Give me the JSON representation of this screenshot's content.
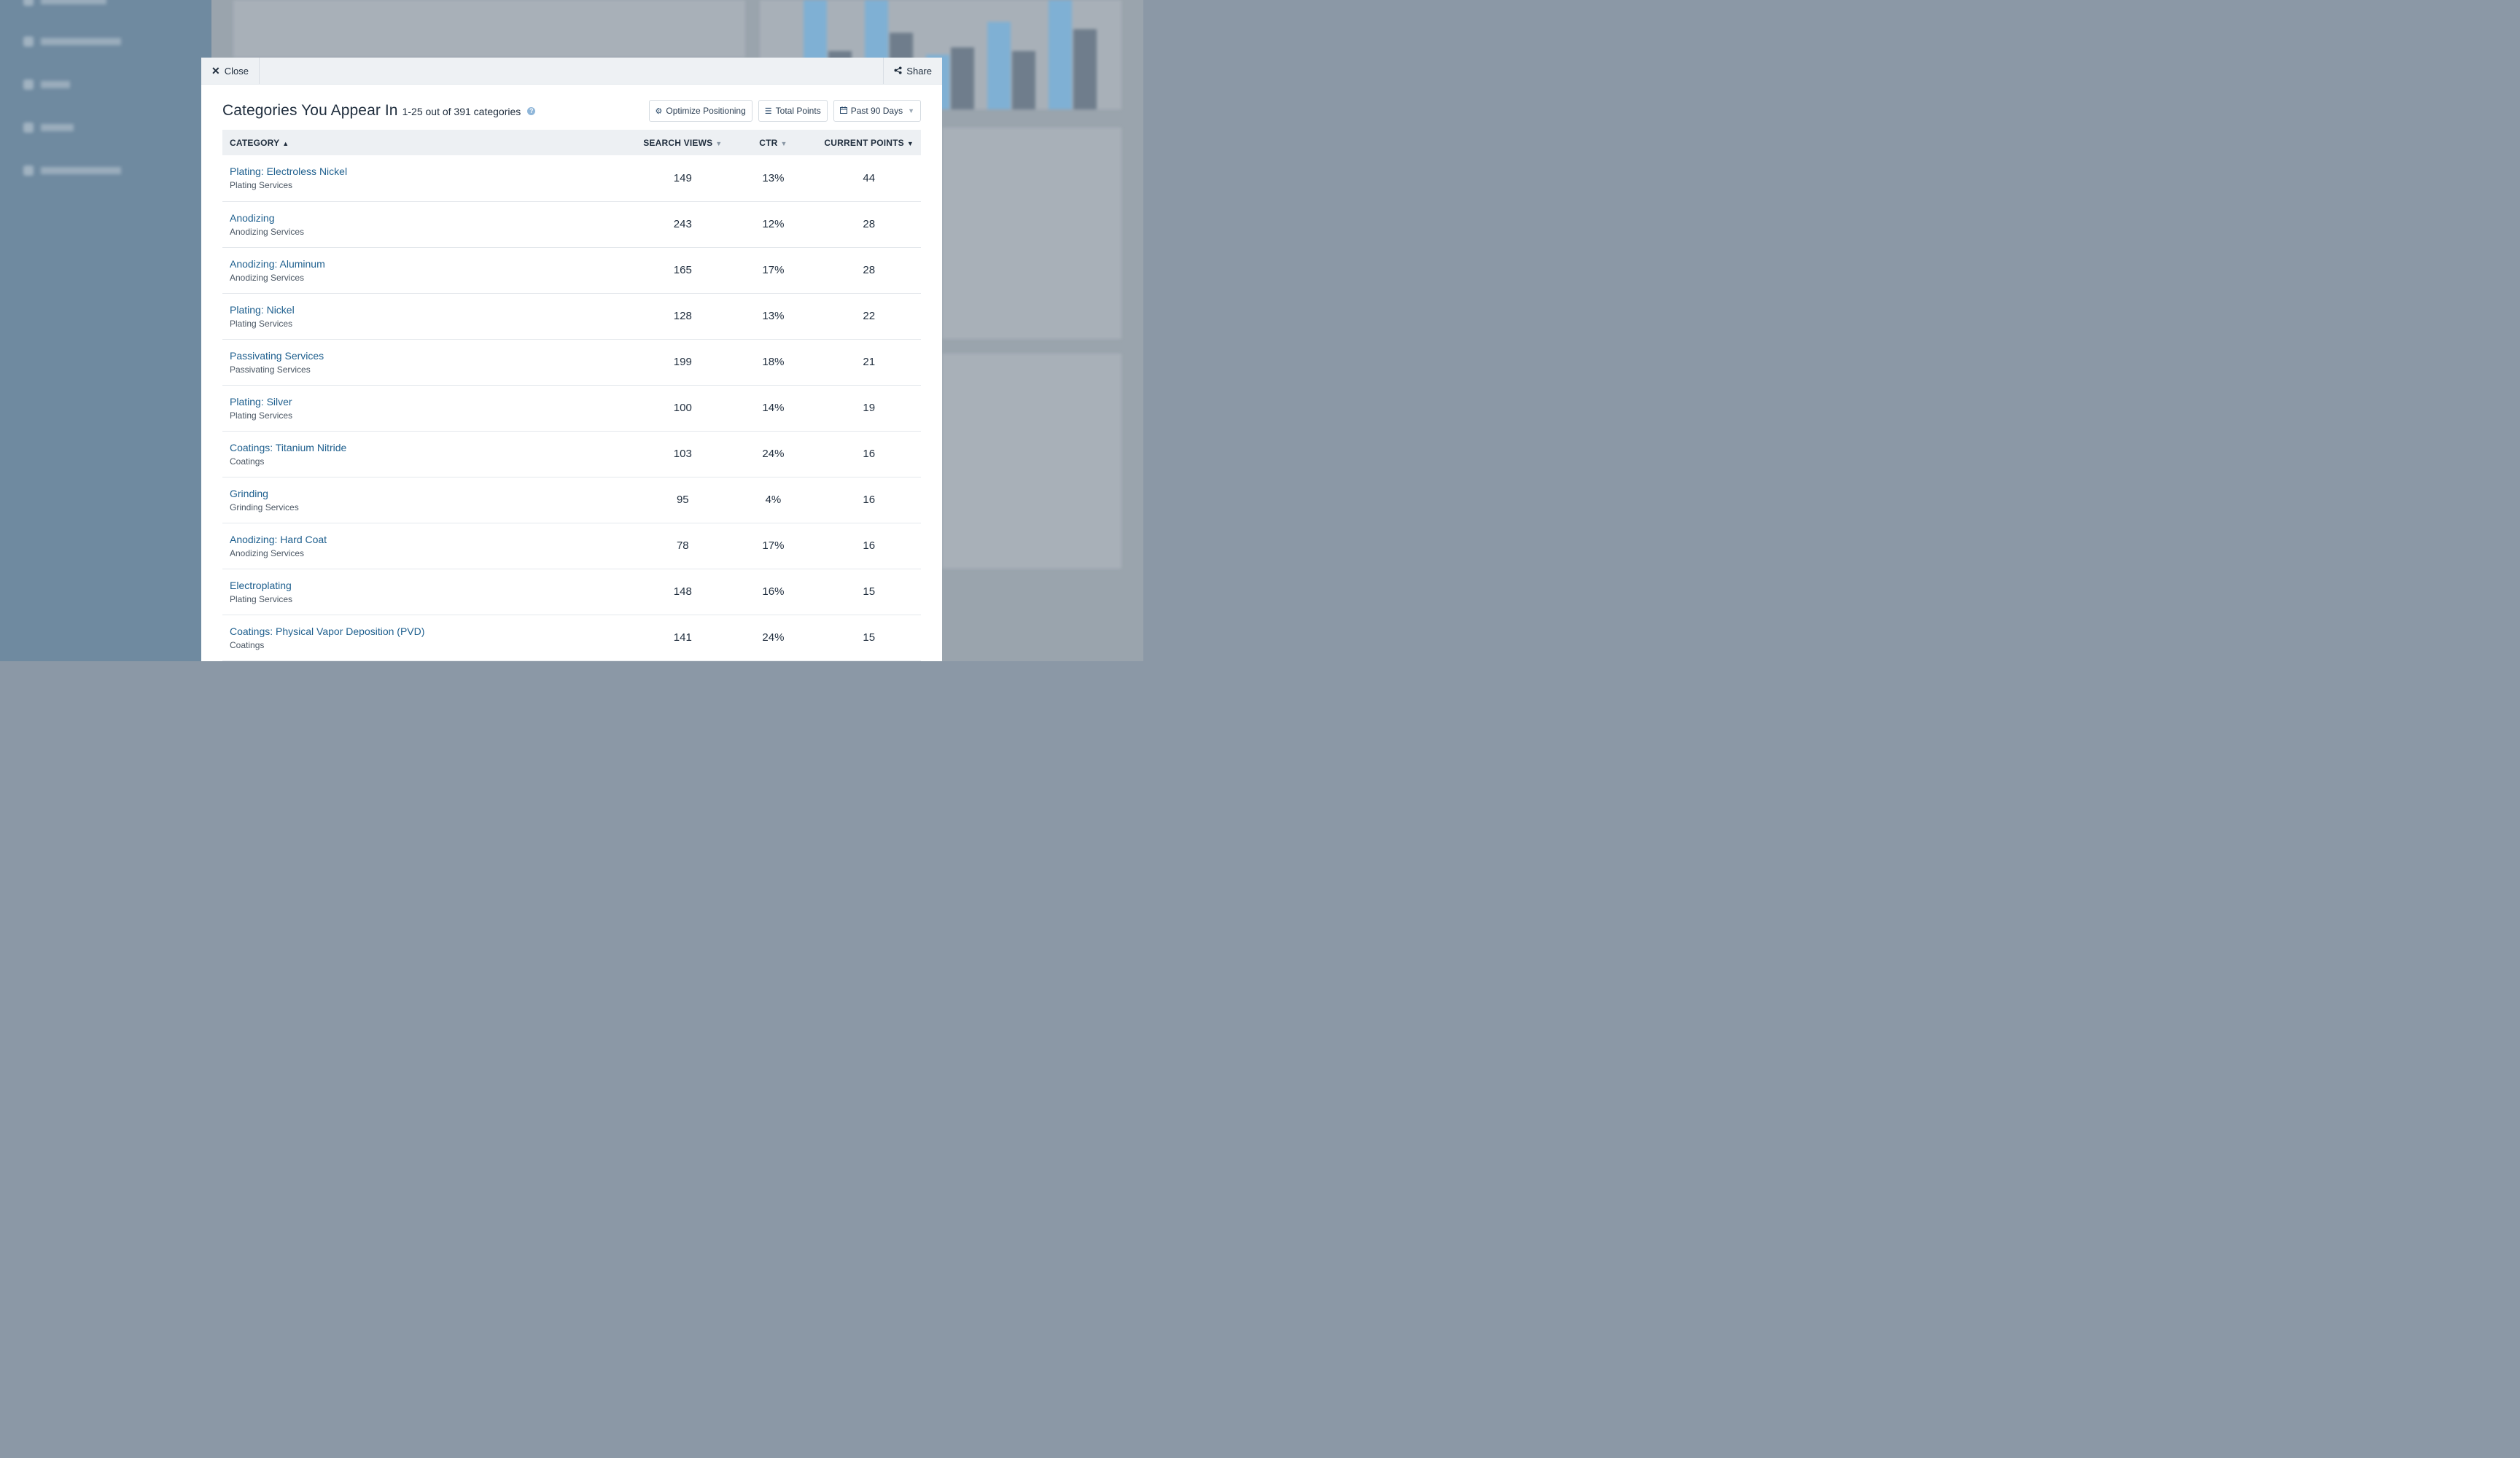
{
  "modal": {
    "close_label": "Close",
    "share_label": "Share",
    "title": "Categories You Appear In",
    "subtitle": "1-25 out of 391 categories",
    "help_glyph": "?",
    "actions": {
      "optimize_label": "Optimize Positioning",
      "points_label": "Total Points",
      "range_label": "Past 90 Days"
    },
    "columns": {
      "category": "CATEGORY",
      "search_views": "SEARCH VIEWS",
      "ctr": "CTR",
      "current_points": "CURRENT POINTS"
    },
    "rows": [
      {
        "name": "Plating: Electroless Nickel",
        "parent": "Plating Services",
        "views": "149",
        "ctr": "13%",
        "points": "44"
      },
      {
        "name": "Anodizing",
        "parent": "Anodizing Services",
        "views": "243",
        "ctr": "12%",
        "points": "28"
      },
      {
        "name": "Anodizing: Aluminum",
        "parent": "Anodizing Services",
        "views": "165",
        "ctr": "17%",
        "points": "28"
      },
      {
        "name": "Plating: Nickel",
        "parent": "Plating Services",
        "views": "128",
        "ctr": "13%",
        "points": "22"
      },
      {
        "name": "Passivating Services",
        "parent": "Passivating Services",
        "views": "199",
        "ctr": "18%",
        "points": "21"
      },
      {
        "name": "Plating: Silver",
        "parent": "Plating Services",
        "views": "100",
        "ctr": "14%",
        "points": "19"
      },
      {
        "name": "Coatings: Titanium Nitride",
        "parent": "Coatings",
        "views": "103",
        "ctr": "24%",
        "points": "16"
      },
      {
        "name": "Grinding",
        "parent": "Grinding Services",
        "views": "95",
        "ctr": "4%",
        "points": "16"
      },
      {
        "name": "Anodizing: Hard Coat",
        "parent": "Anodizing Services",
        "views": "78",
        "ctr": "17%",
        "points": "16"
      },
      {
        "name": "Electroplating",
        "parent": "Plating Services",
        "views": "148",
        "ctr": "16%",
        "points": "15"
      },
      {
        "name": "Coatings: Physical Vapor Deposition (PVD)",
        "parent": "Coatings",
        "views": "141",
        "ctr": "24%",
        "points": "15"
      }
    ]
  },
  "colors": {
    "link": "#1e5f8e",
    "header_bg": "#edf0f3",
    "overlay_sidebar": "#6f8aa0",
    "chart_light": "#7fb0d4",
    "chart_dark": "#6f7d8c"
  }
}
